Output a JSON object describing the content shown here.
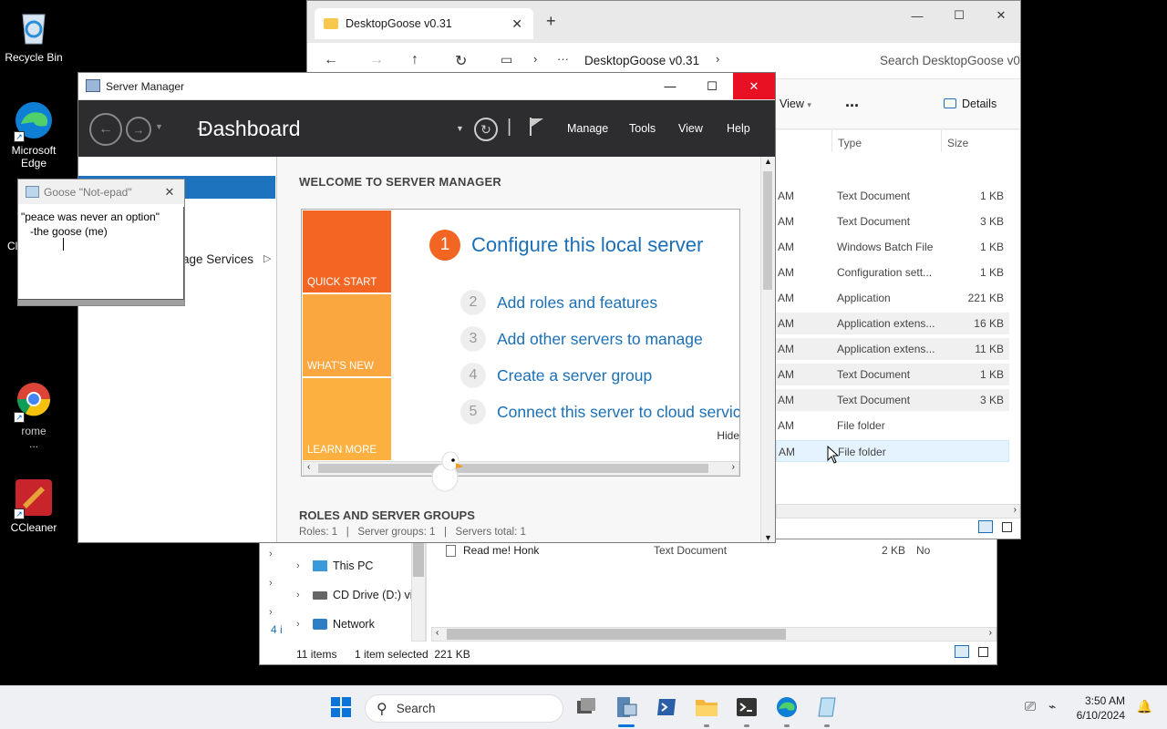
{
  "desktop": {
    "icons": [
      {
        "label": "Recycle Bin"
      },
      {
        "label": "Microsoft Edge"
      },
      {
        "label": "Cl"
      },
      {
        "label": "rome\n..."
      },
      {
        "label": "CCleaner"
      }
    ]
  },
  "explorer": {
    "tab_title": "DesktopGoose v0.31",
    "address": "DesktopGoose v0.31",
    "search_placeholder": "Search DesktopGoose v0",
    "view_label": "View",
    "more_label": "...",
    "details_label": "Details",
    "col_type": "Type",
    "col_size": "Size",
    "rows": [
      {
        "time": "AM",
        "type": "Text Document",
        "size": "1 KB"
      },
      {
        "time": "AM",
        "type": "Text Document",
        "size": "3 KB"
      },
      {
        "time": "AM",
        "type": "Windows Batch File",
        "size": "1 KB"
      },
      {
        "time": "AM",
        "type": "Configuration sett...",
        "size": "1 KB"
      },
      {
        "time": "AM",
        "type": "Application",
        "size": "221 KB"
      },
      {
        "time": "AM",
        "type": "Application extens...",
        "size": "16 KB"
      },
      {
        "time": "AM",
        "type": "Application extens...",
        "size": "11 KB"
      },
      {
        "time": "AM",
        "type": "Text Document",
        "size": "1 KB"
      },
      {
        "time": "AM",
        "type": "Text Document",
        "size": "3 KB"
      },
      {
        "time": "AM",
        "type": "File folder",
        "size": ""
      },
      {
        "time": "AM",
        "type": "File folder",
        "size": ""
      }
    ],
    "lower_file": {
      "name": "Read me! Honk",
      "type": "Text Document",
      "size": "2 KB",
      "extra": "No"
    },
    "nav": [
      {
        "label": "This PC"
      },
      {
        "label": "CD Drive (D:) vir"
      },
      {
        "label": "Network"
      }
    ],
    "left_count": "4 i",
    "status_items": "11 items",
    "status_selected": "1 item selected  221 KB"
  },
  "server_manager": {
    "title": "Server Manager",
    "breadcrumb": "Dashboard",
    "menu": [
      "Manage",
      "Tools",
      "View",
      "Help"
    ],
    "left_partial": "age Services",
    "welcome_heading": "WELCOME TO SERVER MANAGER",
    "tiles": [
      "QUICK START",
      "WHAT'S NEW",
      "LEARN MORE"
    ],
    "steps": [
      {
        "num": "1",
        "label": "Configure this local server"
      },
      {
        "num": "2",
        "label": "Add roles and features"
      },
      {
        "num": "3",
        "label": "Add other servers to manage"
      },
      {
        "num": "4",
        "label": "Create a server group"
      },
      {
        "num": "5",
        "label": "Connect this server to cloud servic"
      }
    ],
    "hide_label": "Hide",
    "roles_heading": "ROLES AND SERVER GROUPS",
    "roles_summary": "Roles: 1   |   Server groups: 1   |   Servers total: 1"
  },
  "goose_notepad": {
    "title": "Goose \"Not-epad\"",
    "line1": "\"peace was never an option\"",
    "line2": "   -the goose (me)"
  },
  "taskbar": {
    "search_label": "Search",
    "time": "3:50 AM",
    "date": "6/10/2024"
  }
}
